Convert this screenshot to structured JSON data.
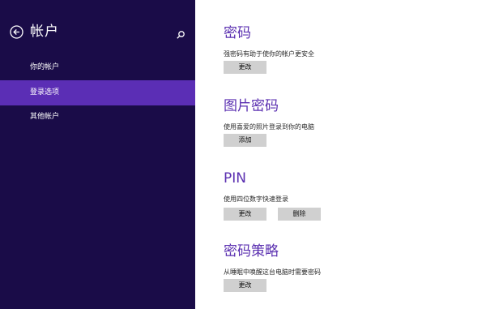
{
  "sidebar": {
    "title": "帐户",
    "back_icon": "back-arrow-icon",
    "search_icon": "search-icon",
    "items": [
      {
        "label": "你的帐户",
        "active": false
      },
      {
        "label": "登录选项",
        "active": true
      },
      {
        "label": "其他帐户",
        "active": false
      }
    ]
  },
  "main": {
    "password": {
      "title": "密码",
      "desc": "强密码有助于使你的帐户更安全",
      "button": "更改"
    },
    "picture_password": {
      "title": "图片密码",
      "desc": "使用喜爱的照片登录到你的电脑",
      "button": "添加"
    },
    "pin": {
      "title": "PIN",
      "desc": "使用四位数字快速登录",
      "button_change": "更改",
      "button_delete": "删除"
    },
    "policy": {
      "title": "密码策略",
      "desc": "从睡眠中唤醒这台电脑时需要密码",
      "button": "更改"
    }
  },
  "colors": {
    "sidebar_bg": "#1a0c48",
    "sidebar_active": "#5b2eb5",
    "accent": "#5a2fb0"
  }
}
